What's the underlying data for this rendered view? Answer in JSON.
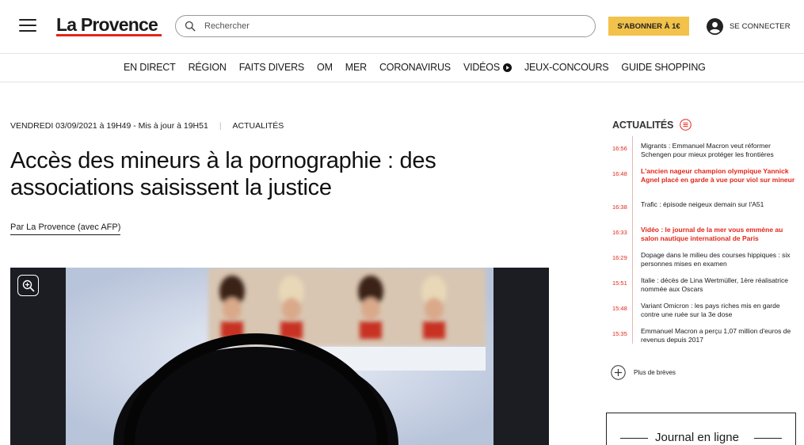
{
  "header": {
    "logo_text": "La Provence",
    "search_placeholder": "Rechercher",
    "subscribe_label": "S'ABONNER À 1€",
    "login_label": "SE CONNECTER",
    "brand_color": "#e2261a",
    "subscribe_color": "#f2c24a"
  },
  "nav": {
    "items": [
      "EN DIRECT",
      "RÉGION",
      "FAITS DIVERS",
      "OM",
      "MER",
      "CORONAVIRUS",
      "VIDÉOS",
      "JEUX-CONCOURS",
      "GUIDE SHOPPING"
    ]
  },
  "article": {
    "date": "VENDREDI 03/09/2021 à 19H49 - Mis à jour à 19H51",
    "category": "ACTUALITÉS",
    "title": "Accès des mineurs à la pornographie : des associations saisissent la justice",
    "byline": "Par La Provence (avec AFP)"
  },
  "sidebar": {
    "title": "ACTUALITÉS",
    "items": [
      {
        "time": "16:56",
        "text": "Migrants : Emmanuel Macron veut réformer Schengen pour mieux protéger les frontières",
        "highlight": false
      },
      {
        "time": "16:48",
        "text": "L'ancien nageur champion olympique Yannick Agnel placé en garde à vue pour viol sur mineur",
        "highlight": true
      },
      {
        "time": "16:38",
        "text": "Trafic : épisode neigeux demain sur l'A51",
        "highlight": false
      },
      {
        "time": "16:33",
        "text": "Vidéo : le journal de la mer vous emmène au salon nautique international de Paris",
        "highlight": true
      },
      {
        "time": "16:29",
        "text": "Dopage dans le milieu des courses hippiques : six personnes mises en examen",
        "highlight": false
      },
      {
        "time": "15:51",
        "text": "Italie : décès de Lina Wertmüller, 1ère réalisatrice nommée aux Oscars",
        "highlight": false
      },
      {
        "time": "15:48",
        "text": "Variant Omicron : les pays riches mis en garde contre une ruée sur la 3e dose",
        "highlight": false
      },
      {
        "time": "15:35",
        "text": "Emmanuel Macron a perçu 1,07 million d'euros de revenus depuis 2017",
        "highlight": false
      }
    ],
    "more_label": "Plus de brèves",
    "journal_title": "Journal en ligne"
  }
}
